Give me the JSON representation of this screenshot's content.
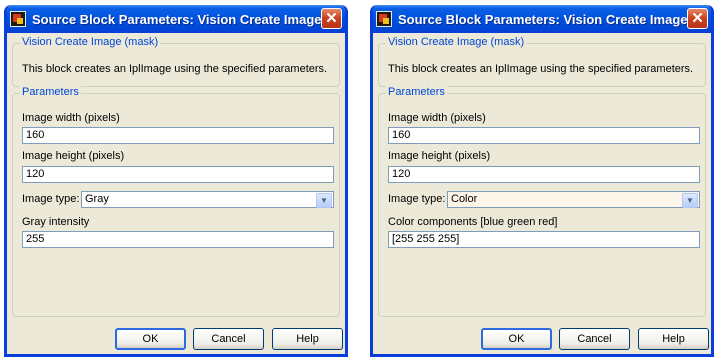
{
  "dialogs": [
    {
      "title": "Source Block Parameters: Vision Create Image",
      "close_glyph": "✕",
      "mask_group": "Vision Create Image (mask)",
      "description": "This block creates an IplImage using the specified parameters.",
      "params_group": "Parameters",
      "width_label": "Image width (pixels)",
      "width_value": "160",
      "height_label": "Image height (pixels)",
      "height_value": "120",
      "type_label": "Image type:",
      "type_value": "Gray",
      "extra_label": "Gray intensity",
      "extra_value": "255",
      "ok": "OK",
      "cancel": "Cancel",
      "help": "Help"
    },
    {
      "title": "Source Block Parameters: Vision Create Image",
      "close_glyph": "✕",
      "mask_group": "Vision Create Image (mask)",
      "description": "This block creates an IplImage using the specified parameters.",
      "params_group": "Parameters",
      "width_label": "Image width (pixels)",
      "width_value": "160",
      "height_label": "Image height (pixels)",
      "height_value": "120",
      "type_label": "Image type:",
      "type_value": "Color",
      "extra_label": "Color components [blue green red]",
      "extra_value": "[255 255 255]",
      "ok": "OK",
      "cancel": "Cancel",
      "help": "Help"
    }
  ],
  "icons": {
    "app": "simulink-block-icon",
    "close": "close-icon",
    "dropdown": "chevron-down-icon"
  },
  "colors": {
    "titlebar": "#0052df",
    "dialog_bg": "#ece9d8",
    "close_button": "#c8411d",
    "group_legend": "#0046d5"
  }
}
